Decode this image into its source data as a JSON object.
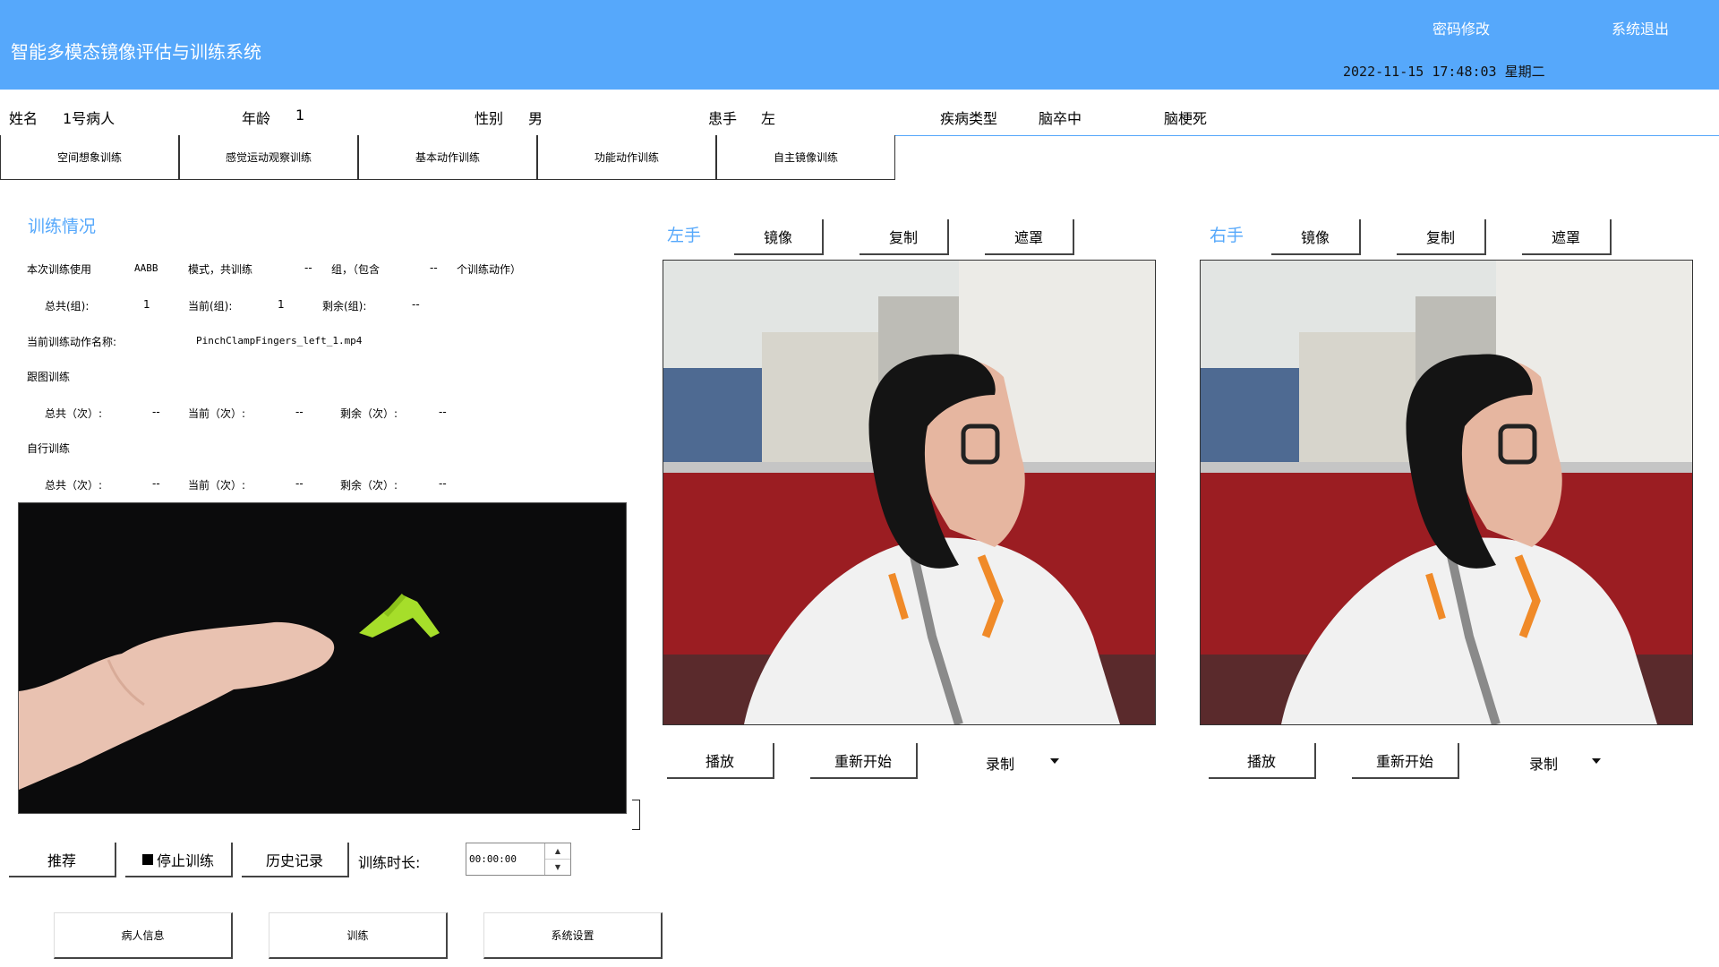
{
  "header": {
    "title": "智能多模态镜像评估与训练系统",
    "change_password": "密码修改",
    "exit": "系统退出",
    "datetime": "2022-11-15 17:48:03 星期二"
  },
  "patient": {
    "name_label": "姓名",
    "name_value": "1号病人",
    "age_label": "年龄",
    "age_value": "1",
    "gender_label": "性别",
    "gender_value": "男",
    "hand_label": "患手",
    "hand_value": "左",
    "disease_label": "疾病类型",
    "disease_value": "脑卒中",
    "disease_subtype": "脑梗死"
  },
  "tabs": [
    {
      "label": "空间想象训练"
    },
    {
      "label": "感觉运动观察训练"
    },
    {
      "label": "基本动作训练"
    },
    {
      "label": "功能动作训练"
    },
    {
      "label": "自主镜像训练"
    }
  ],
  "training": {
    "section_title": "训练情况",
    "line1": {
      "prefix": "本次训练使用",
      "pattern": "AABB",
      "mode": "模式，共训练",
      "groups": "--",
      "group_text": "组，（包含",
      "actions": "--",
      "action_text": "个训练动作）"
    },
    "groups_row": {
      "total_label": "总共(组):",
      "total_value": "1",
      "current_label": "当前(组):",
      "current_value": "1",
      "remaining_label": "剩余(组):",
      "remaining_value": "--"
    },
    "current_action_label": "当前训练动作名称:",
    "current_action_value": "PinchClampFingers_left_1.mp4",
    "follow_title": "跟图训练",
    "follow_row": {
      "total_label": "总共（次）:",
      "total_value": "--",
      "current_label": "当前（次）:",
      "current_value": "--",
      "remaining_label": "剩余（次）:",
      "remaining_value": "--"
    },
    "self_title": "自行训练",
    "self_row": {
      "total_label": "总共（次）:",
      "total_value": "--",
      "current_label": "当前（次）:",
      "current_value": "--",
      "remaining_label": "剩余（次）:",
      "remaining_value": "--"
    }
  },
  "controls": {
    "recommend": "推荐",
    "stop_icon": "stop-square-icon",
    "stop": "停止训练",
    "history": "历史记录",
    "duration_label": "训练时长:",
    "duration_value": "00:00:00"
  },
  "bottom_nav": [
    {
      "label": "病人信息"
    },
    {
      "label": "训练"
    },
    {
      "label": "系统设置"
    }
  ],
  "left_hand": {
    "label": "左手",
    "mirror": "镜像",
    "copy": "复制",
    "mask": "遮罩",
    "play": "播放",
    "restart": "重新开始",
    "record": "录制"
  },
  "right_hand": {
    "label": "右手",
    "mirror": "镜像",
    "copy": "复制",
    "mask": "遮罩",
    "play": "播放",
    "restart": "重新开始",
    "record": "录制"
  },
  "colors": {
    "header_bg": "#56a8fb",
    "accent_text": "#56a8fb"
  }
}
